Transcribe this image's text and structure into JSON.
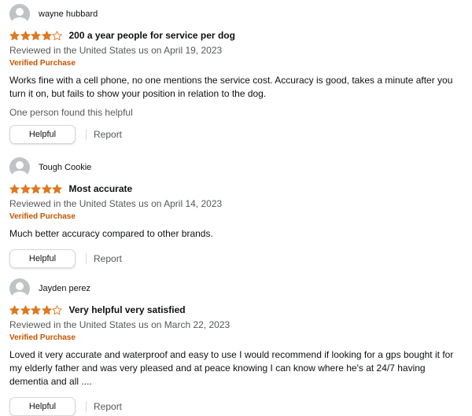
{
  "colors": {
    "star": "#de7921",
    "verified": "#c45500",
    "meta": "#565959",
    "text": "#0f1111"
  },
  "reviews": [
    {
      "author": "wayne hubbard",
      "rating": 4,
      "title": "200 a year people for service per dog",
      "meta": "Reviewed in the United States us on April 19, 2023",
      "verified": "Verified Purchase",
      "body": "Works fine with a cell phone, no one mentions the service cost. Accuracy is good, takes a minute after you turn it on, but fails to show your position in relation to the dog.",
      "helpful_count": "One person found this helpful",
      "helpful_label": "Helpful",
      "report_label": "Report"
    },
    {
      "author": "Tough Cookie",
      "rating": 5,
      "title": "Most accurate",
      "meta": "Reviewed in the United States us on April 14, 2023",
      "verified": "Verified Purchase",
      "body": "Much better accuracy compared to other brands.",
      "helpful_label": "Helpful",
      "report_label": "Report"
    },
    {
      "author": "Jayden perez",
      "rating": 4,
      "title": "Very helpful very satisfied",
      "meta": "Reviewed in the United States us on March 22, 2023",
      "verified": "Verified Purchase",
      "body": "Loved it very accurate and waterproof and easy to use I would recommend if looking for a gps bought it for my elderly father and was very pleased and at peace knowing I can know where he's at 24/7 having dementia and all ....",
      "helpful_label": "Helpful",
      "report_label": "Report"
    }
  ]
}
